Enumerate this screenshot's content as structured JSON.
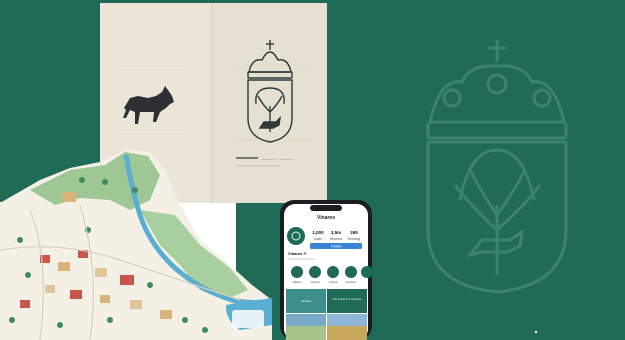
{
  "scene": {
    "description_free": true,
    "colors": {
      "brand_green": "#1f6b58",
      "paper": "#ece6da",
      "paper_shade": "#e2dbcc",
      "map_base": "#f3efe6",
      "river": "#5aaed1",
      "forest": "#8fbe8c",
      "phone_body": "#1a1d22"
    },
    "icons": [
      "wolf-icon",
      "crown-icon",
      "tree-icon",
      "coat-of-arms-icon"
    ]
  },
  "brochure": {
    "caption_line": "———— · ————"
  },
  "phone": {
    "profile": {
      "handle": "Vinares",
      "stats": [
        {
          "value": "1,000",
          "label": "posts"
        },
        {
          "value": "3,5m",
          "label": "followers"
        },
        {
          "value": "265",
          "label": "following"
        }
      ],
      "name": "Vinares ®",
      "follow_label": "Follow",
      "highlights": [
        "Historia",
        "Turismo",
        "Cultura",
        "Eventos",
        "Rutas"
      ]
    },
    "posts": [
      "",
      "Ola turismo & Vinares",
      "",
      "Vinares"
    ]
  }
}
